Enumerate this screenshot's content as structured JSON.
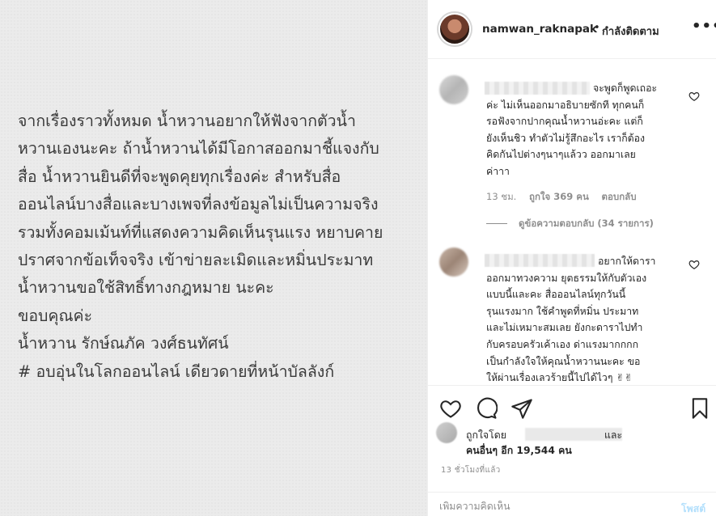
{
  "post": {
    "lines": [
      "จากเรื่องราวทั้งหมด น้ำหวานอยากให้ฟังจากตัวน้ำ",
      "หวานเองนะคะ ถ้าน้ำหวานได้มีโอกาสออกมาชี้แจงกับ",
      "สื่อ น้ำหวานยินดีที่จะพูดคุยทุกเรื่องค่ะ สำหรับสื่อ",
      "ออนไลน์บางสื่อและบางเพจที่ลงข้อมูลไม่เป็นความจริง",
      "รวมทั้งคอมเม้นท์ที่แสดงความคิดเห็นรุนแรง หยาบคาย",
      "ปราศจากข้อเท็จจริง เข้าข่ายละเมิดและหมิ่นประมาท",
      "น้ำหวานขอใช้สิทธิ์ทางกฎหมาย นะคะ",
      "ขอบคุณค่ะ",
      "น้ำหวาน รักษ์ณภัค วงศ์ธนทัศน์",
      "# อบอุ่นในโลกออนไลน์ เดียวดายที่หน้าบัลลังก์"
    ]
  },
  "header": {
    "username": "namwan_raknapak",
    "dot": "•",
    "follow_status": "กำลังติดตาม",
    "more": "•••"
  },
  "comments": [
    {
      "lines": [
        "จะพูดก็พูดเถอะ",
        "ค่ะ ไม่เห็นออกมาอธิบายซักที ทุกคนก็",
        "รอฟังจากปากคุณน้ำหวานอ่ะคะ แต่ก็",
        "ยังเห็นชิว ทำตัวไม่รู้สึกอะไร เราก็ต้อง",
        "คิดกันไปต่างๆนาๆแล้วว ออกมาเลย",
        "ค่าาา"
      ],
      "time": "13 ชม.",
      "likes": "ถูกใจ 369 คน",
      "reply": "ตอบกลับ"
    },
    {
      "lines": [
        "อยากให้ดารา",
        "ออกมาทวงความ ยุตธรรมให้กับตัวเอง",
        "แบบนี้และคะ สื่อออนไลน์ทุกวันนี้",
        "รุนแรงมาก ใช้คำพูดที่หมิ่น ประมาท",
        "และไม่เหมาะสมเลย ยังกะดาราไปทำ",
        "กับครอบครัวเค้าเอง ด่าแรงมากกกก",
        "เป็นกำลังใจให้คุณน้ำหวานนะคะ ขอ",
        "ให้ผ่านเรื่องเลวร้ายนี้ไปได้ไวๆ ✌✌"
      ]
    }
  ],
  "replies_label": "ดูข้อความตอบกลับ (34 รายการ)",
  "likes": {
    "liked_by": "ถูกใจโดย",
    "and": "และ",
    "others": "คนอื่นๆ อีก 19,544 คน"
  },
  "post_time": "13 ชั่วโมงที่แล้ว",
  "add_comment": {
    "placeholder": "เพิ่มความคิดเห็น",
    "post_label": "โพสต์"
  },
  "colors": {
    "text": "#262626",
    "muted": "#8e8e8e",
    "post_button": "#b2dffc",
    "image_bg": "#ebebeb"
  },
  "icons": [
    "heart-icon",
    "comment-icon",
    "share-icon",
    "bookmark-icon"
  ]
}
